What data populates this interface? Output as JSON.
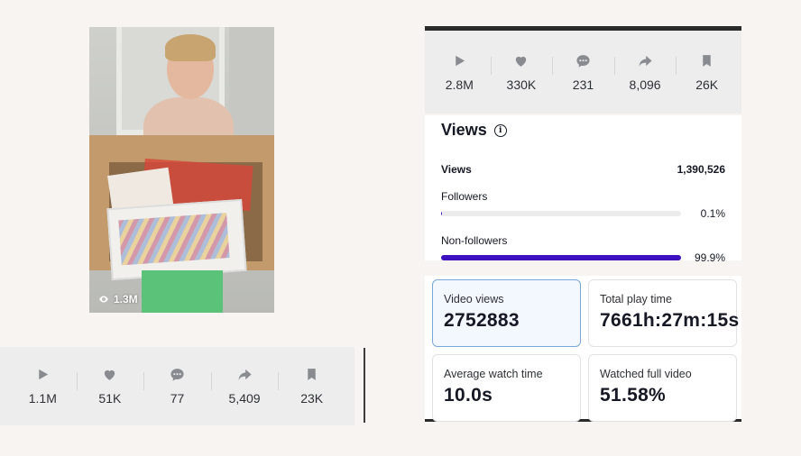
{
  "video": {
    "view_count": "1.3M"
  },
  "left_stats": [
    {
      "icon": "play-icon",
      "value": "1.1M"
    },
    {
      "icon": "heart-icon",
      "value": "51K"
    },
    {
      "icon": "comment-icon",
      "value": "77"
    },
    {
      "icon": "share-icon",
      "value": "5,409"
    },
    {
      "icon": "bookmark-icon",
      "value": "23K"
    }
  ],
  "right_stats": [
    {
      "icon": "play-icon",
      "value": "2.8M"
    },
    {
      "icon": "heart-icon",
      "value": "330K"
    },
    {
      "icon": "comment-icon",
      "value": "231"
    },
    {
      "icon": "share-icon",
      "value": "8,096"
    },
    {
      "icon": "bookmark-icon",
      "value": "26K"
    }
  ],
  "views_card": {
    "title": "Views",
    "total_label": "Views",
    "total_value": "1,390,526",
    "followers": {
      "label": "Followers",
      "percent_text": "0.1%",
      "fraction": 0.001
    },
    "non_followers": {
      "label": "Non-followers",
      "percent_text": "99.9%",
      "fraction": 0.999
    },
    "accent_color": "#3d10c0"
  },
  "metrics": {
    "video_views": {
      "label": "Video views",
      "value": "2752883"
    },
    "total_play_time": {
      "label": "Total play time",
      "value": "7661h:27m:15s"
    },
    "average_watch_time": {
      "label": "Average watch time",
      "value": "10.0s"
    },
    "watched_full_video": {
      "label": "Watched full video",
      "value": "51.58%"
    }
  }
}
